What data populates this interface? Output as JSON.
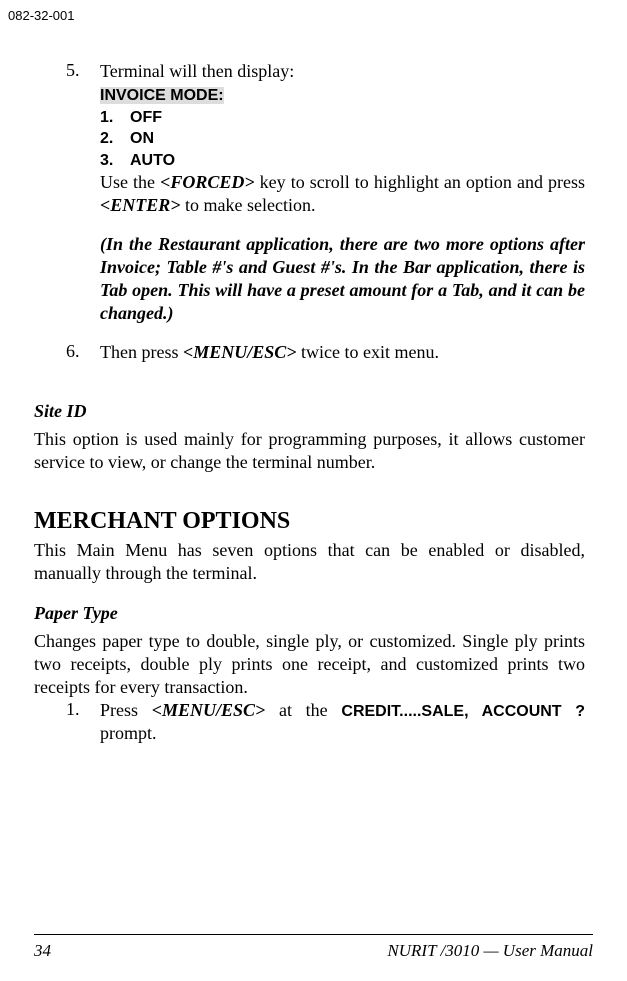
{
  "document_id": "082-32-001",
  "item5": {
    "num": "5.",
    "intro": "Terminal will then display:",
    "invoice_mode": "INVOICE MODE:",
    "opt1_num": "1.",
    "opt1_label": "OFF",
    "opt2_num": "2.",
    "opt2_label": "ON",
    "opt3_num": "3.",
    "opt3_label": "AUTO",
    "use_1": "Use the ",
    "use_forced": "<FORCED>",
    "use_2": " key to scroll to highlight an option and press ",
    "use_enter": "<ENTER>",
    "use_3": " to make selection.",
    "note": "(In the Restaurant application, there are two more options after Invoice; Table #'s and Guest #'s.  In the Bar application, there is Tab open.  This will have a preset amount for a Tab, and it can be changed.)"
  },
  "item6": {
    "num": "6.",
    "t1": "Then press ",
    "key": "<MENU/ESC>",
    "t2": " twice to exit menu."
  },
  "siteid": {
    "heading": "Site ID",
    "body": "This option is used mainly for programming purposes, it allows customer service to view, or change the terminal number."
  },
  "merchant": {
    "heading": "MERCHANT OPTIONS",
    "body": "This Main Menu has seven options that can be enabled or disabled, manually through the terminal."
  },
  "paper": {
    "heading": "Paper Type",
    "body": "Changes paper type to double, single ply, or customized. Single ply prints two receipts, double ply prints one receipt, and customized prints two receipts for every transaction.",
    "item1_num": "1.",
    "item1_t1": "Press ",
    "item1_key": "<MENU/ESC>",
    "item1_t2": " at the ",
    "item1_bold": "CREDIT.....SALE, ACCOUNT ?",
    "item1_t3": " prompt."
  },
  "footer": {
    "page_num": "34",
    "right": "NURIT /3010 — User Manual"
  }
}
